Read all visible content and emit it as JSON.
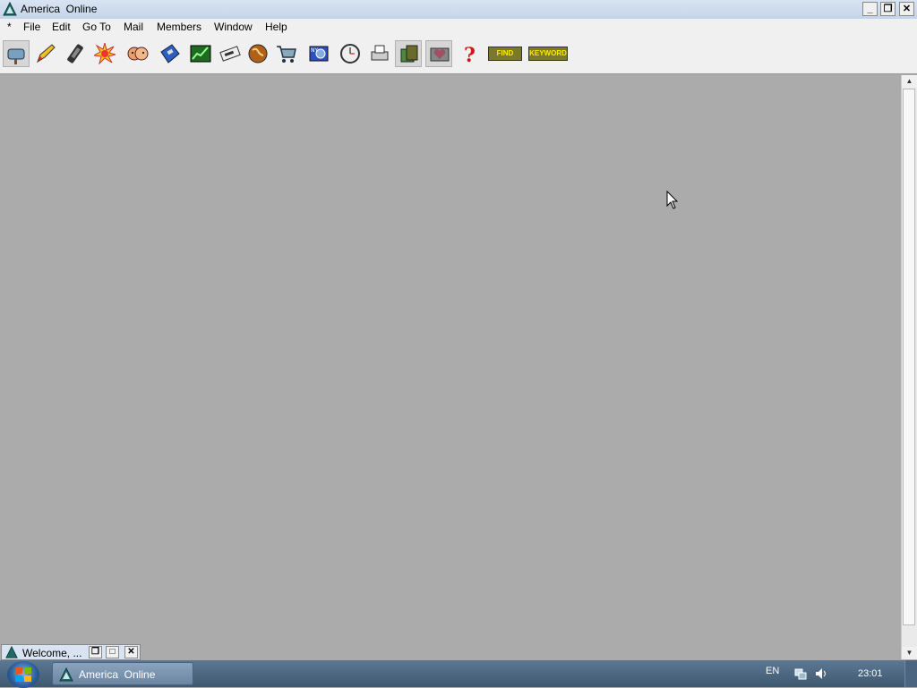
{
  "window": {
    "title": "America  Online"
  },
  "menubar": {
    "items": [
      "*",
      "File",
      "Edit",
      "Go To",
      "Mail",
      "Members",
      "Window",
      "Help"
    ]
  },
  "toolbar": {
    "icons": [
      "mailbox",
      "compose-pencil",
      "phone",
      "hot-burst",
      "people",
      "disk",
      "stocks",
      "news",
      "globe",
      "shopping-cart",
      "picture",
      "clock",
      "printer",
      "wallet",
      "heart",
      "help-question"
    ],
    "find_label": "FIND",
    "keyword_label": "KEYWORD"
  },
  "minimized_window": {
    "title": "Welcome, ..."
  },
  "taskbar": {
    "task_label": "America  Online",
    "lang": "EN",
    "clock": "23:01"
  },
  "colors": {
    "desktop": "#ababab",
    "titlebar": "#c4d4e8",
    "taskbar": "#4a6380"
  }
}
